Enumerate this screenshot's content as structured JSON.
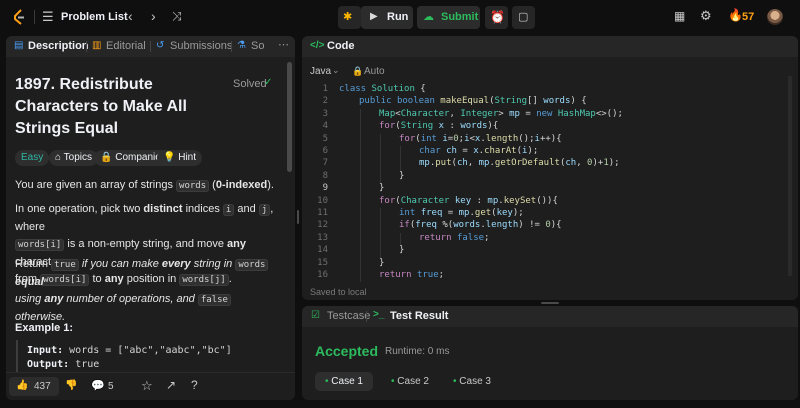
{
  "topbar": {
    "problem_list": "Problem List",
    "run": "Run",
    "submit": "Submit",
    "streak": "57"
  },
  "left": {
    "tabs": [
      "Description",
      "Editorial",
      "Submissions",
      "So"
    ],
    "title_lines": [
      "1897. Redistribute",
      "Characters to Make All",
      "Strings Equal"
    ],
    "status": "Solved",
    "tags": [
      "Easy",
      "Topics",
      "Companies",
      "Hint"
    ],
    "p1a": "You are given an array of strings ",
    "p1code": "words",
    "p1b": " (",
    "p1bold": "0-indexed",
    "p1c": ").",
    "p2a": "In one operation, pick two ",
    "p2bold1": "distinct",
    "p2b": " indices ",
    "p2code1": "i",
    "p2c": " and ",
    "p2code2": "j",
    "p2d": ", where",
    "p2code3": "words[i]",
    "p2e": " is a non-empty string, and move ",
    "p2bold2": "any",
    "p2f": " character",
    "p2g": "from ",
    "p2code4": "words[i]",
    "p2h": " to ",
    "p2bold3": "any",
    "p2i": " position in ",
    "p2code5": "words[j]",
    "p2j": ".",
    "p3a": "Return ",
    "p3code1": "true",
    "p3b": " if you can make ",
    "p3bold1": "every",
    "p3c": " string in ",
    "p3code2": "words",
    "p3bold2": "equal",
    "p3d": "using ",
    "p3bold3": "any",
    "p3e": " number of operations, and ",
    "p3code3": "false",
    "p3f": " otherwise.",
    "example_title": "Example 1:",
    "input_label": "Input:",
    "input_value": "words = [\"abc\",\"aabc\",\"bc\"]",
    "output_label": "Output:",
    "output_value": "true",
    "likes": "437",
    "comments": "5"
  },
  "editor": {
    "tab": "Code",
    "language": "Java",
    "auto": "Auto",
    "saved": "Saved to local",
    "line_numbers": [
      "1",
      "2",
      "3",
      "4",
      "5",
      "6",
      "7",
      "8",
      "9",
      "10",
      "11",
      "12",
      "13",
      "14",
      "15",
      "16"
    ]
  },
  "result": {
    "tabs": [
      "Testcase",
      "Test Result"
    ],
    "status": "Accepted",
    "runtime": "Runtime: 0 ms",
    "cases": [
      "Case 1",
      "Case 2",
      "Case 3"
    ],
    "accent": "#2cbb5d"
  }
}
